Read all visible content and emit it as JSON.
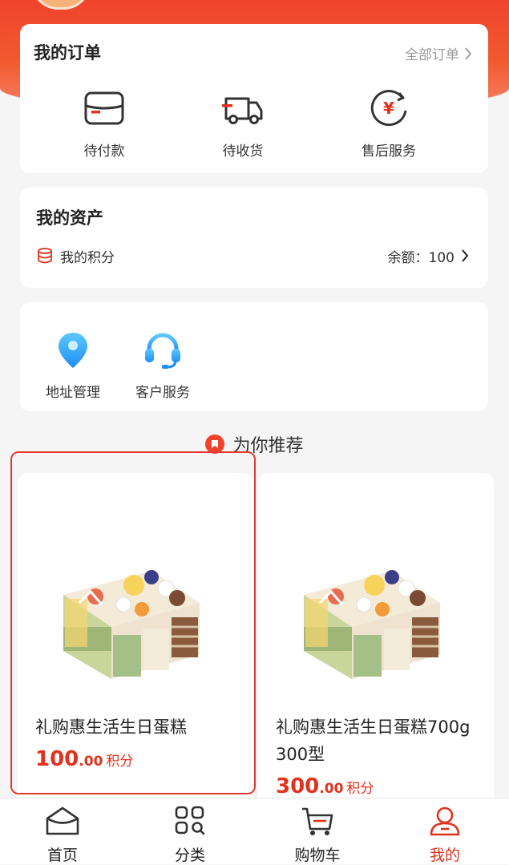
{
  "orders": {
    "title": "我的订单",
    "all_label": "全部订单",
    "items": [
      {
        "label": "待付款",
        "icon": "wallet-icon"
      },
      {
        "label": "待收货",
        "icon": "truck-icon"
      },
      {
        "label": "售后服务",
        "icon": "yen-refresh-icon"
      }
    ]
  },
  "assets": {
    "title": "我的资产",
    "points_label": "我的积分",
    "balance_label": "余额：100"
  },
  "services": {
    "items": [
      {
        "label": "地址管理",
        "icon": "location-pin-icon"
      },
      {
        "label": "客户服务",
        "icon": "headset-icon"
      }
    ]
  },
  "recommend": {
    "title": "为你推荐",
    "products": [
      {
        "name": "礼购惠生活生日蛋糕",
        "price_int": "100",
        "price_dec": ".00",
        "unit": "积分"
      },
      {
        "name": "礼购惠生活生日蛋糕700g 300型",
        "price_int": "300",
        "price_dec": ".00",
        "unit": "积分"
      }
    ]
  },
  "tabbar": {
    "tabs": [
      {
        "label": "首页",
        "icon": "home-icon"
      },
      {
        "label": "分类",
        "icon": "category-grid-icon"
      },
      {
        "label": "购物车",
        "icon": "cart-icon"
      },
      {
        "label": "我的",
        "icon": "user-icon"
      }
    ],
    "active_index": 3
  },
  "colors": {
    "accent": "#e2311d",
    "header": "#f0432c"
  }
}
